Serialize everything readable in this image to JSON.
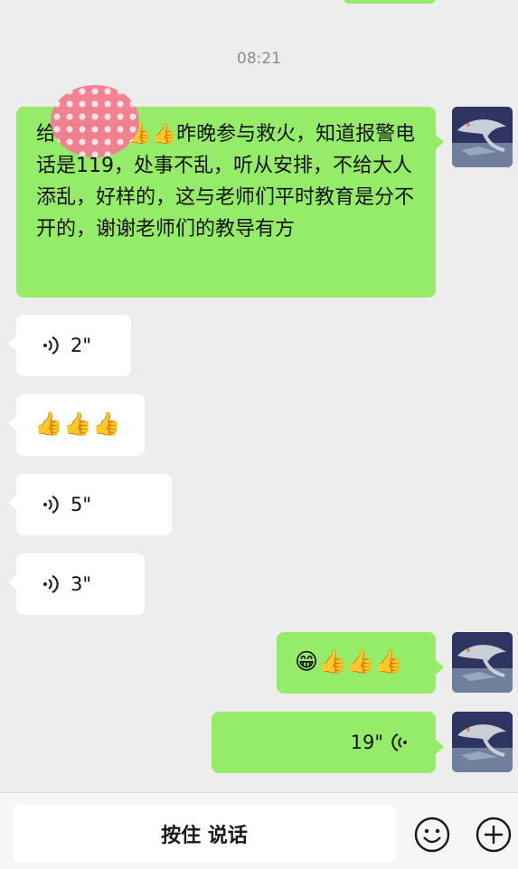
{
  "chat": {
    "timestamp": "08:21",
    "first_message": {
      "text": "给 点赞👍👍👍昨晚参与救火，知道报警电话是119，处事不乱，听从安排，不给大人添乱，好样的，这与老师们平时教育是分不开的，谢谢老师们的教导有方"
    },
    "voice_1": {
      "duration": "2\""
    },
    "thumbs_message": {
      "text": "👍👍👍"
    },
    "voice_2": {
      "duration": "5\""
    },
    "voice_3": {
      "duration": "3\""
    },
    "own_emoji_message": {
      "text": "😁👍👍👍"
    },
    "own_voice": {
      "duration": "19\""
    }
  },
  "input_bar": {
    "hold_to_talk_label": "按住 说话",
    "emoji_button": "emoji-face-icon",
    "plus_button": "plus-icon"
  },
  "colors": {
    "background": "#ededed",
    "own_bubble": "#95ec69",
    "other_bubble": "#ffffff",
    "timestamp": "#8c8c8c"
  }
}
